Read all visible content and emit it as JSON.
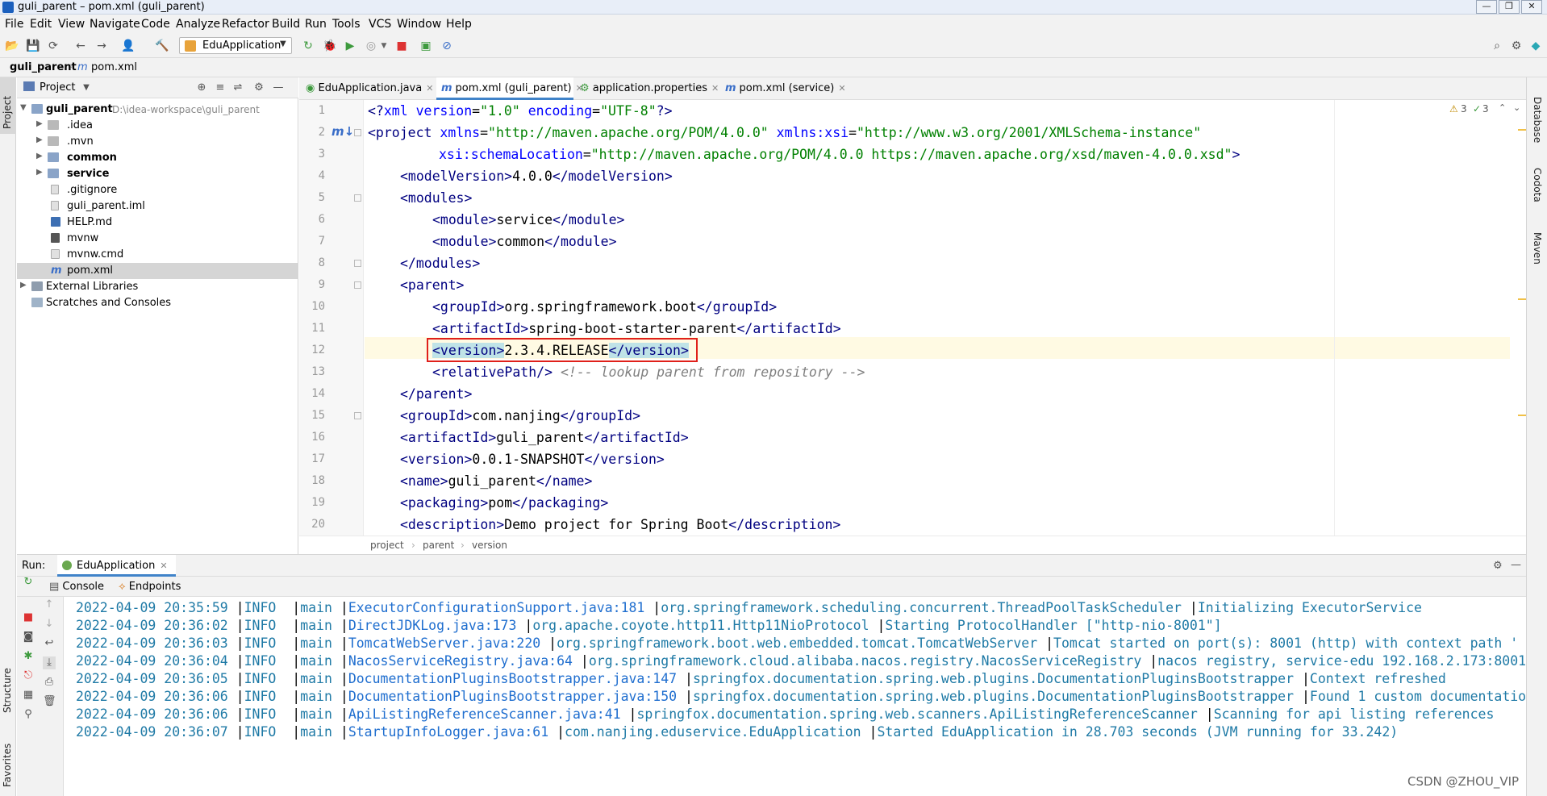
{
  "window": {
    "title": "guli_parent – pom.xml (guli_parent)",
    "controls": [
      "—",
      "❐",
      "✕"
    ]
  },
  "menu": [
    "File",
    "Edit",
    "View",
    "Navigate",
    "Code",
    "Analyze",
    "Refactor",
    "Build",
    "Run",
    "Tools",
    "VCS",
    "Window",
    "Help"
  ],
  "toolbar": {
    "run_config": "EduApplication"
  },
  "breadcrumb": {
    "project": "guli_parent",
    "file": "pom.xml"
  },
  "left_stripe": {
    "project": "Project",
    "structure": "Structure",
    "favorites": "Favorites"
  },
  "project_panel": {
    "title": "Project",
    "tree": [
      {
        "label": "guli_parent",
        "path": "D:\\idea-workspace\\guli_parent",
        "bold": true,
        "expanded": true
      },
      {
        "label": ".idea",
        "bold": false
      },
      {
        "label": ".mvn",
        "bold": false
      },
      {
        "label": "common",
        "bold": true
      },
      {
        "label": "service",
        "bold": true
      },
      {
        "label": ".gitignore",
        "bold": false
      },
      {
        "label": "guli_parent.iml",
        "bold": false
      },
      {
        "label": "HELP.md",
        "bold": false
      },
      {
        "label": "mvnw",
        "bold": false
      },
      {
        "label": "mvnw.cmd",
        "bold": false
      },
      {
        "label": "pom.xml",
        "bold": false,
        "selected": true
      },
      {
        "label": "External Libraries",
        "bold": false
      },
      {
        "label": "Scratches and Consoles",
        "bold": false
      }
    ]
  },
  "editor": {
    "tabs": [
      {
        "label": "EduApplication.java",
        "active": false
      },
      {
        "label": "pom.xml (guli_parent)",
        "active": true
      },
      {
        "label": "application.properties",
        "active": false
      },
      {
        "label": "pom.xml (service)",
        "active": false
      }
    ],
    "inspections": {
      "warnings": "3",
      "weak_warnings": "3"
    },
    "line_numbers": [
      "1",
      "2",
      "3",
      "4",
      "5",
      "6",
      "7",
      "8",
      "9",
      "10",
      "11",
      "12",
      "13",
      "14",
      "15",
      "16",
      "17",
      "18",
      "19",
      "20"
    ],
    "status_path": [
      "project",
      "parent",
      "version"
    ]
  },
  "right_stripe": {
    "database": "Database",
    "codota": "Codota",
    "maven": "Maven"
  },
  "run_panel": {
    "label": "Run:",
    "tab": "EduApplication",
    "subtabs": [
      "Console",
      "Endpoints"
    ],
    "log": [
      {
        "date": "2022-04-09 20:35:59",
        "level": "INFO",
        "thread": "main",
        "source": "ExecutorConfigurationSupport.java:181",
        "class": "org.springframework.scheduling.concurrent.ThreadPoolTaskScheduler",
        "msg": "Initializing ExecutorService"
      },
      {
        "date": "2022-04-09 20:36:02",
        "level": "INFO",
        "thread": "main",
        "source": "DirectJDKLog.java:173",
        "class": "org.apache.coyote.http11.Http11NioProtocol",
        "msg": "Starting ProtocolHandler [\"http-nio-8001\"]"
      },
      {
        "date": "2022-04-09 20:36:03",
        "level": "INFO",
        "thread": "main",
        "source": "TomcatWebServer.java:220",
        "class": "org.springframework.boot.web.embedded.tomcat.TomcatWebServer",
        "msg": "Tomcat started on port(s): 8001 (http) with context path '"
      },
      {
        "date": "2022-04-09 20:36:04",
        "level": "INFO",
        "thread": "main",
        "source": "NacosServiceRegistry.java:64",
        "class": "org.springframework.cloud.alibaba.nacos.registry.NacosServiceRegistry",
        "msg": "nacos registry, service-edu 192.168.2.173:8001"
      },
      {
        "date": "2022-04-09 20:36:05",
        "level": "INFO",
        "thread": "main",
        "source": "DocumentationPluginsBootstrapper.java:147",
        "class": "springfox.documentation.spring.web.plugins.DocumentationPluginsBootstrapper",
        "msg": "Context refreshed"
      },
      {
        "date": "2022-04-09 20:36:06",
        "level": "INFO",
        "thread": "main",
        "source": "DocumentationPluginsBootstrapper.java:150",
        "class": "springfox.documentation.spring.web.plugins.DocumentationPluginsBootstrapper",
        "msg": "Found 1 custom documentatio"
      },
      {
        "date": "2022-04-09 20:36:06",
        "level": "INFO",
        "thread": "main",
        "source": "ApiListingReferenceScanner.java:41",
        "class": "springfox.documentation.spring.web.scanners.ApiListingReferenceScanner",
        "msg": "Scanning for api listing references"
      },
      {
        "date": "2022-04-09 20:36:07",
        "level": "INFO",
        "thread": "main",
        "source": "StartupInfoLogger.java:61",
        "class": "com.nanjing.eduservice.EduApplication",
        "msg": "Started EduApplication in 28.703 seconds (JVM running for 33.242)"
      }
    ]
  },
  "code": {
    "l1_a": "<?",
    "l1_b": "xml version",
    "l1_c": "=",
    "l1_d": "\"1.0\"",
    "l1_e": " encoding",
    "l1_f": "=",
    "l1_g": "\"UTF-8\"",
    "l1_h": "?>",
    "l2_tag": "<project",
    "l2_attr1": " xmlns",
    "l2_val1": "\"http://maven.apache.org/POM/4.0.0\"",
    "l2_attr2": " xmlns:xsi",
    "l2_val2": "\"http://www.w3.org/2001/XMLSchema-instance\"",
    "l3_attr": "xsi:schemaLocation",
    "l3_val": "\"http://maven.apache.org/POM/4.0.0 https://maven.apache.org/xsd/maven-4.0.0.xsd\"",
    "l3_end": ">",
    "l4": [
      "<modelVersion>",
      "4.0.0",
      "</modelVersion>"
    ],
    "l5": "<modules>",
    "l6": [
      "<module>",
      "service",
      "</module>"
    ],
    "l7": [
      "<module>",
      "common",
      "</module>"
    ],
    "l8": "</modules>",
    "l9": "<parent>",
    "l10": [
      "<groupId>",
      "org.springframework.boot",
      "</groupId>"
    ],
    "l11": [
      "<artifactId>",
      "spring-boot-starter-parent",
      "</artifactId>"
    ],
    "l12": [
      "<version>",
      "2.3.4.RELEASE",
      "</version>"
    ],
    "l13_tag": "<relativePath/>",
    "l13_cmt": "<!-- lookup parent from repository -->",
    "l14": "</parent>",
    "l15": [
      "<groupId>",
      "com.nanjing",
      "</groupId>"
    ],
    "l16": [
      "<artifactId>",
      "guli_parent",
      "</artifactId>"
    ],
    "l17": [
      "<version>",
      "0.0.1-SNAPSHOT",
      "</version>"
    ],
    "l18": [
      "<name>",
      "guli_parent",
      "</name>"
    ],
    "l19": [
      "<packaging>",
      "pom",
      "</packaging>"
    ],
    "l20": [
      "<description>",
      "Demo project for Spring Boot",
      "</description>"
    ]
  },
  "watermark": "CSDN @ZHOU_VIP"
}
